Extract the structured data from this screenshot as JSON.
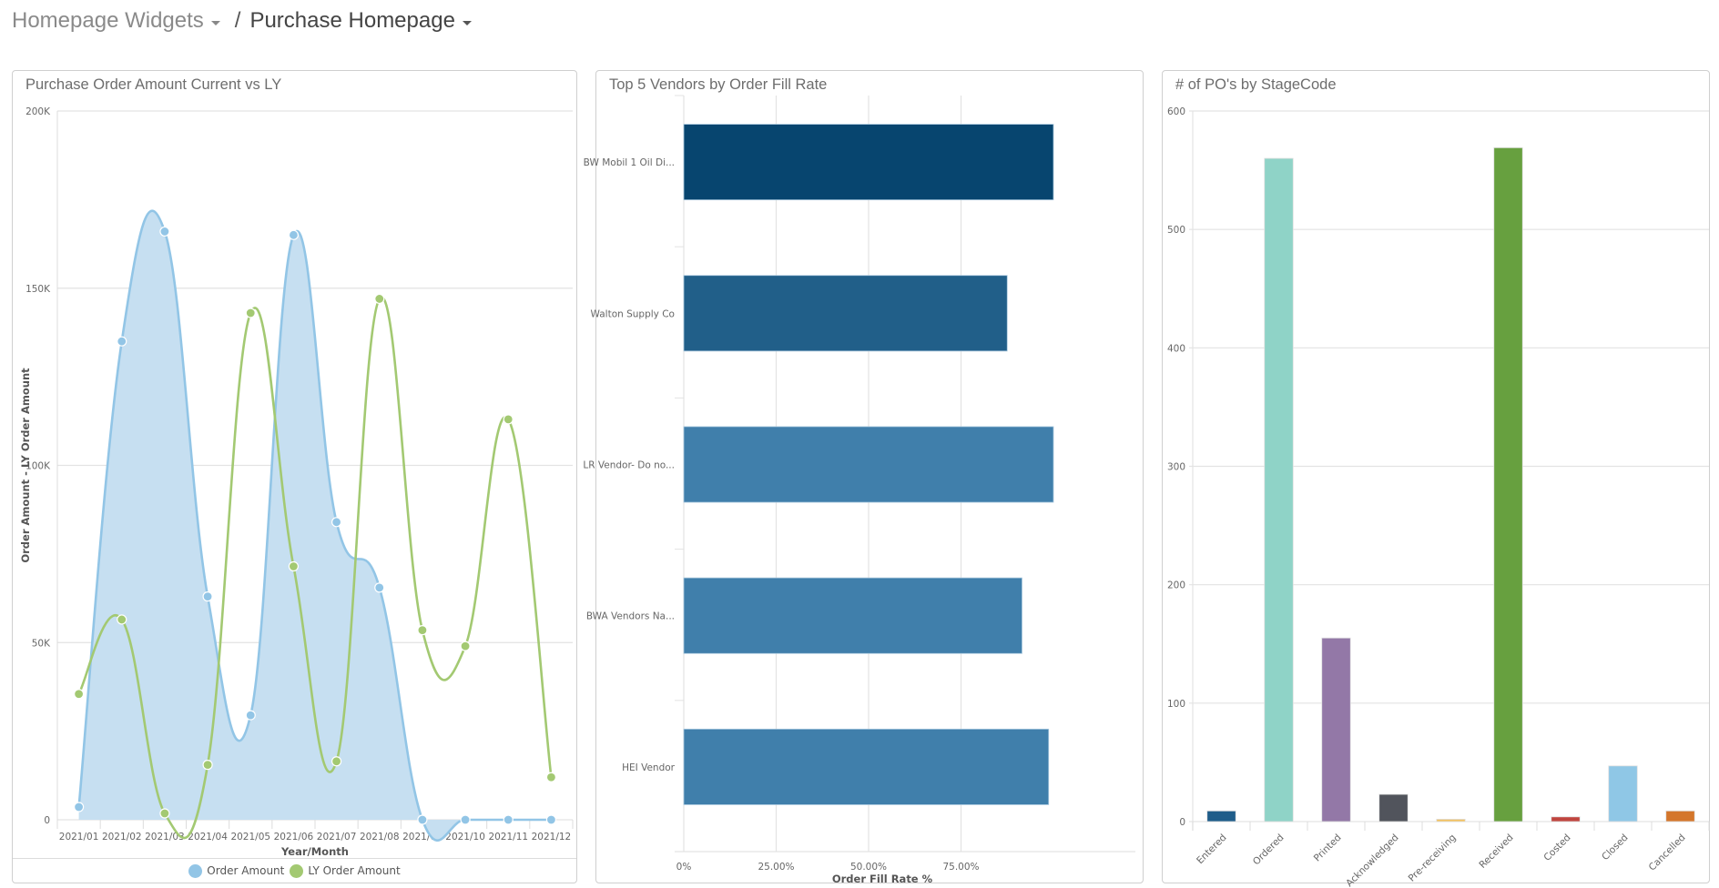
{
  "breadcrumb": {
    "items": [
      {
        "label": "Homepage Widgets"
      },
      {
        "label": "Purchase Homepage"
      }
    ],
    "separator": "/"
  },
  "colors": {
    "order_amount": "#92c5e6",
    "order_amount_fill": "#c6dff1",
    "ly_order_amount": "#a3c972",
    "vendor_bar_1": "#07456f",
    "vendor_bar_2": "#215f89",
    "vendor_bar_3": "#407fab"
  },
  "widgets": [
    {
      "title": "Purchase Order Amount Current vs LY"
    },
    {
      "title": "Top 5 Vendors by Order Fill Rate"
    },
    {
      "title": "# of PO's by StageCode"
    }
  ],
  "chart_data": [
    {
      "type": "area",
      "title": "Purchase Order Amount Current vs LY",
      "xlabel": "Year/Month",
      "ylabel": "Order Amount  - LY Order Amount",
      "ylim": [
        0,
        200000
      ],
      "yticks": [
        {
          "value": 0,
          "label": "0"
        },
        {
          "value": 50000,
          "label": "50K"
        },
        {
          "value": 100000,
          "label": "100K"
        },
        {
          "value": 150000,
          "label": "150K"
        },
        {
          "value": 200000,
          "label": "200K"
        }
      ],
      "categories": [
        "2021/01",
        "2021/02",
        "2021/03",
        "2021/04",
        "2021/05",
        "2021/06",
        "2021/07",
        "2021/08",
        "2021/09",
        "2021/10",
        "2021/11",
        "2021/12"
      ],
      "series": [
        {
          "name": "Order Amount",
          "style": "area",
          "color": "#92c5e6",
          "values": [
            3600,
            135000,
            166000,
            63000,
            29500,
            165000,
            84000,
            65500,
            0,
            0,
            0,
            0
          ]
        },
        {
          "name": "LY Order Amount",
          "style": "line",
          "color": "#a3c972",
          "values": [
            35500,
            56500,
            1800,
            15500,
            143000,
            71500,
            16500,
            147000,
            53500,
            49000,
            113000,
            12000
          ]
        }
      ],
      "legend": [
        {
          "label": "Order Amount",
          "color": "#92c5e6"
        },
        {
          "label": "LY Order Amount",
          "color": "#a3c972"
        }
      ],
      "legend_position": "bottom",
      "grid": true
    },
    {
      "type": "bar",
      "orientation": "horizontal",
      "title": "Top 5 Vendors by Order Fill Rate",
      "xlabel": "Order Fill Rate %",
      "ylabel": "",
      "xlim": [
        0,
        1
      ],
      "xticks": [
        {
          "value": 0,
          "label": "0%"
        },
        {
          "value": 0.25,
          "label": "25.00%"
        },
        {
          "value": 0.5,
          "label": "50.00%"
        },
        {
          "value": 0.75,
          "label": "75.00%"
        }
      ],
      "categories": [
        "BW Mobil 1 Oil Di...",
        "Walton Supply Co",
        "LR Vendor- Do no...",
        "BWA Vendors Na...",
        "HEI Vendor"
      ],
      "values": [
        1.0,
        0.875,
        1.0,
        0.915,
        0.987
      ],
      "bar_colors": [
        "#07456f",
        "#215f89",
        "#407fab",
        "#407fab",
        "#407fab"
      ],
      "grid": true
    },
    {
      "type": "bar",
      "title": "# of PO's by StageCode",
      "xlabel": "",
      "ylabel": "",
      "ylim": [
        0,
        600
      ],
      "yticks": [
        0,
        100,
        200,
        300,
        400,
        500,
        600
      ],
      "categories": [
        "Entered",
        "Ordered",
        "Printed",
        "Acknowledged",
        "Pre-receiving",
        "Received",
        "Costed",
        "Closed",
        "Cancelled"
      ],
      "values": [
        9,
        560,
        155,
        23,
        2,
        569,
        4,
        47,
        9
      ],
      "bar_colors": [
        "#1f5d8a",
        "#8fd3c7",
        "#9378a7",
        "#51545c",
        "#f3c15f",
        "#67a03f",
        "#c0453f",
        "#8fc7e6",
        "#d4762b"
      ],
      "grid": true
    }
  ]
}
